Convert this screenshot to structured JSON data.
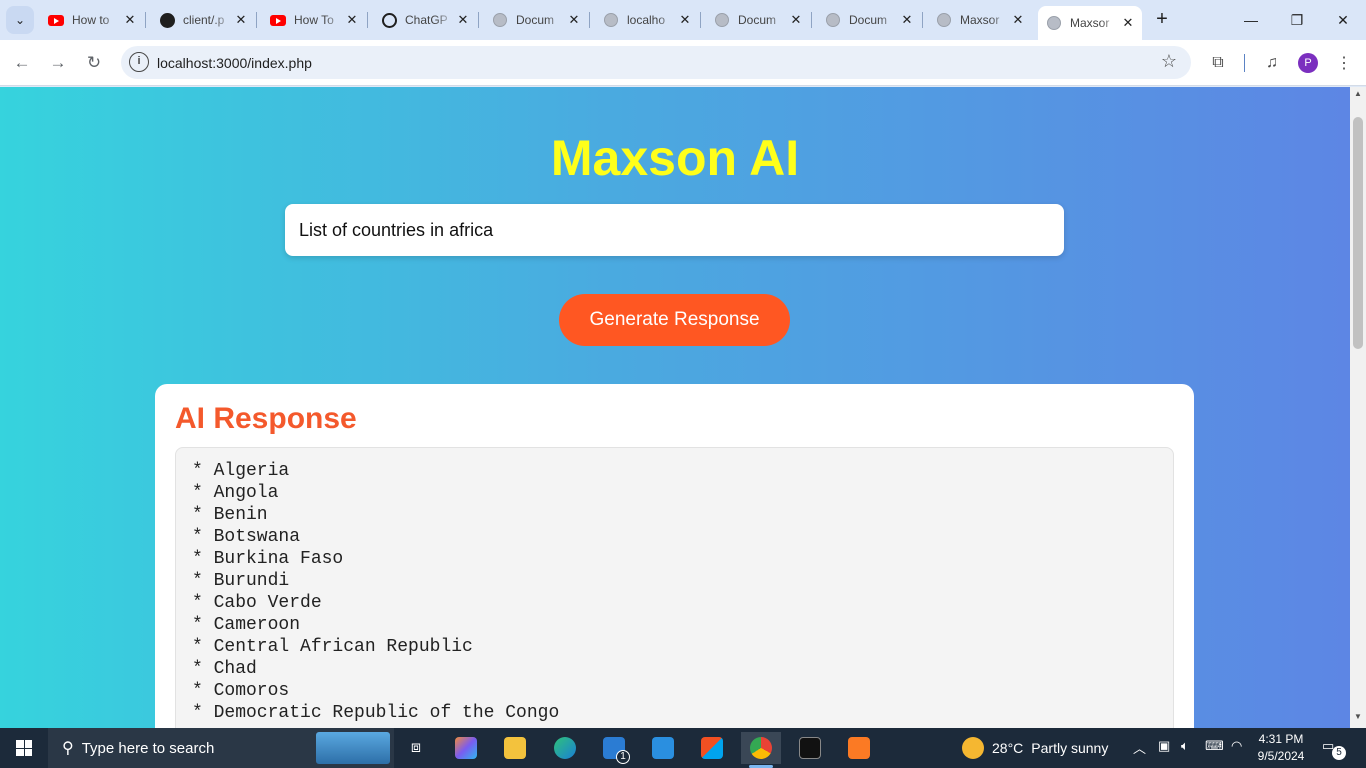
{
  "browser": {
    "tabs": [
      {
        "title": "How to",
        "favicon": "youtube-icon"
      },
      {
        "title": "client/.p",
        "favicon": "github-icon"
      },
      {
        "title": "How To",
        "favicon": "youtube-icon"
      },
      {
        "title": "ChatGP",
        "favicon": "chatgpt-icon"
      },
      {
        "title": "Docum",
        "favicon": "globe-icon"
      },
      {
        "title": "localho",
        "favicon": "globe-icon"
      },
      {
        "title": "Docum",
        "favicon": "globe-icon"
      },
      {
        "title": "Docum",
        "favicon": "globe-icon"
      },
      {
        "title": "Maxsor",
        "favicon": "globe-icon"
      },
      {
        "title": "Maxsor",
        "favicon": "globe-icon",
        "active": true
      }
    ],
    "url": "localhost:3000/index.php",
    "profile_initial": "P"
  },
  "page": {
    "title": "Maxson AI",
    "prompt_value": "List of countries in africa",
    "generate_label": "Generate Response",
    "response_heading": "AI Response",
    "response_items": [
      "* Algeria",
      "* Angola",
      "* Benin",
      "* Botswana",
      "* Burkina Faso",
      "* Burundi",
      "* Cabo Verde",
      "* Cameroon",
      "* Central African Republic",
      "* Chad",
      "* Comoros",
      "* Democratic Republic of the Congo"
    ],
    "colors": {
      "title": "#ffff1a",
      "button": "#ff5722",
      "heading": "#f4592c"
    }
  },
  "taskbar": {
    "search_placeholder": "Type here to search",
    "weather": {
      "temp": "28°C",
      "condition": "Partly sunny"
    },
    "clock": {
      "time": "4:31 PM",
      "date": "9/5/2024"
    },
    "mail_badge": "1",
    "notification_count": "5"
  }
}
